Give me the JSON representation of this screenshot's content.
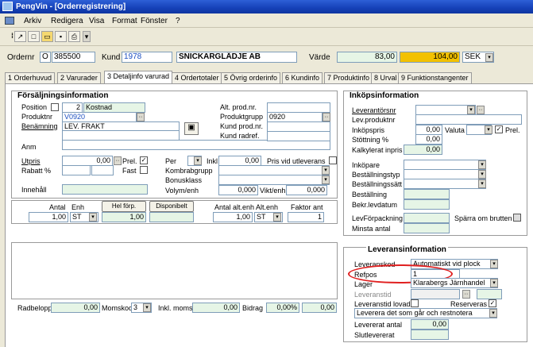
{
  "title": "PengVin - [Orderregistrering]",
  "menu": [
    "Arkiv",
    "Redigera",
    "Visa",
    "Format",
    "Fönster",
    "?"
  ],
  "header": {
    "ordernr_label": "Ordernr",
    "ordernr_prefix": "O",
    "ordernr": "385500",
    "kund_label": "Kund",
    "kund_nr": "1978",
    "kund_namn": "SNICKARGLÄDJE AB",
    "varde_label": "Värde",
    "varde1": "83,00",
    "varde2": "104,00",
    "currency": "SEK"
  },
  "tabs": [
    "1 Orderhuvud",
    "2 Varurader",
    "3 Detaljinfo varurad",
    "4 Ordertotaler",
    "5 Övrig orderinfo",
    "6 Kundinfo",
    "7 Produktinfo",
    "8 Urval",
    "9 Funktionstangenter"
  ],
  "forsalj": {
    "heading": "Försäljningsinformation",
    "position_label": "Position",
    "position": "2",
    "position_type": "Kostnad",
    "produktnr_label": "Produktnr",
    "produktnr": "V0920",
    "benamning_label": "Benämning",
    "benamning": "LEV. FRAKT",
    "anm_label": "Anm",
    "alt_prod_label": "Alt. prod.nr.",
    "produktgrupp_label": "Produktgrupp",
    "produktgrupp": "0920",
    "kund_prod_label": "Kund prod.nr.",
    "kund_radref_label": "Kund radref.",
    "utpris_label": "Utpris",
    "utpris": "0,00",
    "prel_label": "Prel.",
    "rabatt_label": "Rabatt %",
    "fast_label": "Fast",
    "innehall_label": "Innehåll",
    "per_label": "Per",
    "inkl_label": "Inkl",
    "inkl": "0,00",
    "pris_vid_label": "Pris vid utleverans",
    "kombra_label": "Kombrabgrupp",
    "bonus_label": "Bonusklass",
    "volym_label": "Volym/enh",
    "volym": "0,000",
    "vikt_label": "Vikt/enh",
    "vikt": "0,000"
  },
  "antal": {
    "antal_label": "Antal",
    "antal": "1,00",
    "enh_label": "Enh",
    "enh": "ST",
    "hel_label": "Hel förp.",
    "hel": "1,00",
    "disp_label": "Disponibelt",
    "antal_alt_label": "Antal alt.enh",
    "antal_alt": "1,00",
    "alt_enh_label": "Alt.enh",
    "alt_enh": "ST",
    "faktor_label": "Faktor ant",
    "faktor": "1"
  },
  "footer": {
    "radbelopp_label": "Radbelopp",
    "radbelopp": "0,00",
    "momskod_label": "Momskod",
    "momskod": "3",
    "inkl_moms_label": "Inkl. moms",
    "inkl_moms": "0,00",
    "bidrag_label": "Bidrag",
    "bidrag1": "0,00%",
    "bidrag2": "0,00"
  },
  "inkop": {
    "heading": "Inköpsinformation",
    "leverantorsnr_label": "Leverantörsnr",
    "levprodnr_label": "Lev.produktnr",
    "inkopspris_label": "Inköpspris",
    "inkopspris": "0,00",
    "valuta_label": "Valuta",
    "prel_label": "Prel.",
    "stottning_label": "Stöttning %",
    "stottning": "0,00",
    "kalkylerat_label": "Kalkylerat inpris",
    "kalkylerat": "0,00",
    "inkopare_label": "Inköpare",
    "bestallningstyp_label": "Beställningstyp",
    "bestallningssatt_label": "Beställningssätt",
    "bestallning_label": "Beställning",
    "bekr_label": "Bekr.levdatum",
    "levforp_label": "LevFörpackning",
    "sparra_label": "Spärra om brutten",
    "minsta_label": "Minsta antal"
  },
  "lev": {
    "heading": "Leveransinformation",
    "leveranskod_label": "Leveranskod",
    "leveranskod": "Automatiskt vid plock",
    "refpos_label": "Refpos",
    "refpos": "1",
    "lager_label": "Lager",
    "lager": "Klarabergs Järnhandel",
    "leveranstid_label": "Leveranstid",
    "leveranstid_lovad_label": "Leveranstid lovad",
    "reserveras_label": "Reserveras",
    "leverera_opt": "Leverera det som går och restnotera",
    "levererat_label": "Levererat antal",
    "levererat": "0,00",
    "slutlevererat_label": "Slutlevererat"
  },
  "colors": {
    "highlight": "#f2c100",
    "field_green": "#e6f5e6",
    "annotation": "#e02020"
  }
}
